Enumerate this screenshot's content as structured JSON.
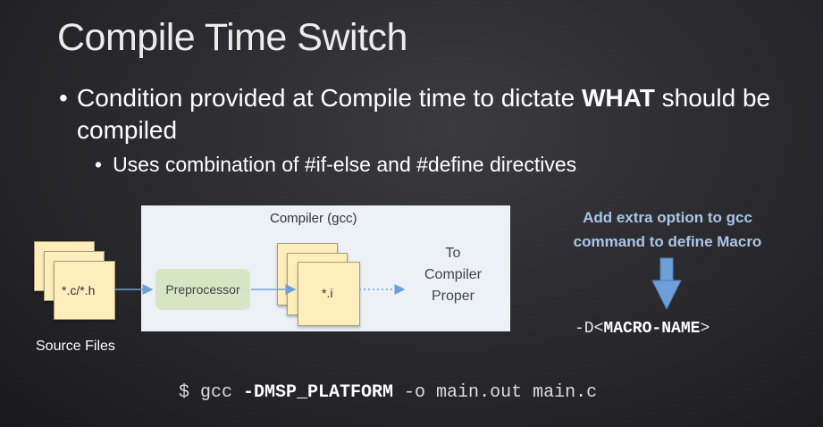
{
  "slide": {
    "title": "Compile Time Switch",
    "bullet_main_prefix": "Condition provided at Compile time to dictate ",
    "bullet_main_bold": "WHAT",
    "bullet_main_suffix": " should be compiled",
    "bullet_sub": "Uses combination of #if-else and #define directives",
    "bullet_glyph": "•"
  },
  "diagram": {
    "compiler_label": "Compiler (gcc)",
    "source_file_label": "*.c/*.h",
    "source_files_caption": "Source Files",
    "preprocessor_label": "Preprocessor",
    "intermediate_file_label": "*.i",
    "destination_label_line1": "To",
    "destination_label_line2": "Compiler",
    "destination_label_line3": "Proper"
  },
  "note": {
    "line1": "Add extra option to gcc",
    "line2": "command to define Macro",
    "macro_prefix": "-D<",
    "macro_name": "MACRO-NAME",
    "macro_suffix": ">"
  },
  "command": {
    "prefix": "$ gcc ",
    "flag": "-DMSP_PLATFORM",
    "suffix": " -o main.out main.c"
  },
  "colors": {
    "background": "#2c2c30",
    "panel": "#ecf1f8",
    "file": "#fdeebb",
    "preprocessor": "#d6e5c4",
    "note_text": "#a9c6e8",
    "arrow": "#6f9fd8"
  }
}
